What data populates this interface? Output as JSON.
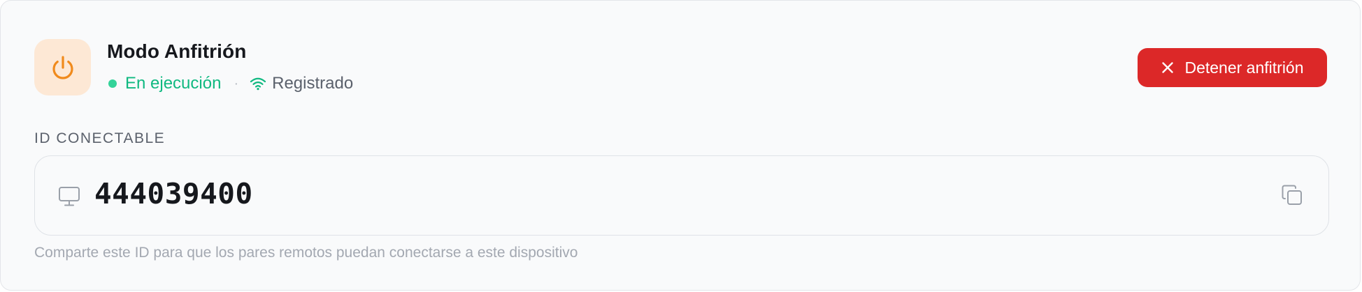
{
  "header": {
    "title": "Modo Anfitrión",
    "status_running": "En ejecución",
    "separator": "·",
    "status_registered": "Registrado",
    "stop_label": "Detener anfitrión",
    "icons": {
      "power": "power-icon",
      "wifi": "wifi-icon",
      "close": "close-icon"
    }
  },
  "connectable_id": {
    "label": "ID CONECTABLE",
    "value": "444039400",
    "hint": "Comparte este ID para que los pares remotos puedan conectarse a este dispositivo",
    "icons": {
      "monitor": "monitor-icon",
      "copy": "copy-icon"
    }
  },
  "colors": {
    "accent_orange": "#f08a1c",
    "power_tile_bg": "#fde8d5",
    "running_green": "#10b981",
    "danger_red": "#dc2828",
    "text_primary": "#16181d",
    "text_muted": "#5b616c",
    "text_hint": "#a3a8b1"
  }
}
